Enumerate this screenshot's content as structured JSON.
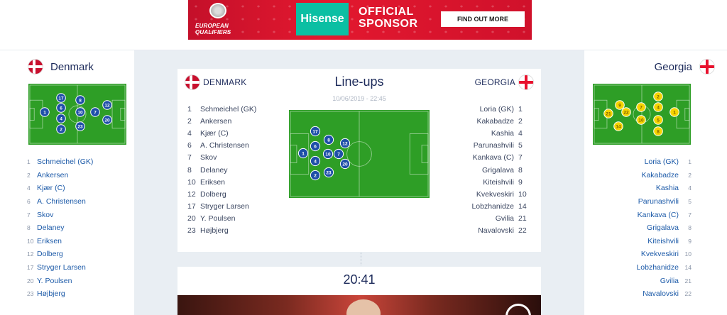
{
  "banner": {
    "eq_text": "EUROPEAN QUALIFIERS",
    "brand": "Hisense",
    "tagline_1": "OFFICIAL",
    "tagline_2": "SPONSOR",
    "cta": "FIND OUT MORE",
    "bg_color": "#d8142c"
  },
  "colors": {
    "pitch": "#2e9e26",
    "home_marker": "#1e4fa8",
    "away_marker": "#f5d400",
    "link": "#1c5aa8",
    "title": "#1c2a5a"
  },
  "home": {
    "name": "Denmark",
    "name_caps": "DENMARK",
    "flag_icon": "denmark-flag-icon",
    "players": [
      {
        "num": "1",
        "name": "Schmeichel (GK)"
      },
      {
        "num": "2",
        "name": "Ankersen"
      },
      {
        "num": "4",
        "name": "Kjær (C)"
      },
      {
        "num": "6",
        "name": "A. Christensen"
      },
      {
        "num": "7",
        "name": "Skov"
      },
      {
        "num": "8",
        "name": "Delaney"
      },
      {
        "num": "10",
        "name": "Eriksen"
      },
      {
        "num": "12",
        "name": "Dolberg"
      },
      {
        "num": "17",
        "name": "Stryger Larsen"
      },
      {
        "num": "20",
        "name": "Y. Poulsen"
      },
      {
        "num": "23",
        "name": "Højbjerg"
      }
    ]
  },
  "away": {
    "name": "Georgia",
    "name_caps": "GEORGIA",
    "flag_icon": "georgia-flag-icon",
    "players": [
      {
        "num": "1",
        "name": "Loria (GK)"
      },
      {
        "num": "2",
        "name": "Kakabadze"
      },
      {
        "num": "4",
        "name": "Kashia"
      },
      {
        "num": "5",
        "name": "Parunashvili"
      },
      {
        "num": "7",
        "name": "Kankava (C)"
      },
      {
        "num": "8",
        "name": "Grigalava"
      },
      {
        "num": "9",
        "name": "Kiteishvili"
      },
      {
        "num": "10",
        "name": "Kvekveskiri"
      },
      {
        "num": "14",
        "name": "Lobzhanidze"
      },
      {
        "num": "21",
        "name": "Gvilia"
      },
      {
        "num": "22",
        "name": "Navalovski"
      }
    ]
  },
  "lineups": {
    "title": "Line-ups",
    "date": "10/06/2019 - 22:45"
  },
  "event": {
    "time": "20:41"
  }
}
